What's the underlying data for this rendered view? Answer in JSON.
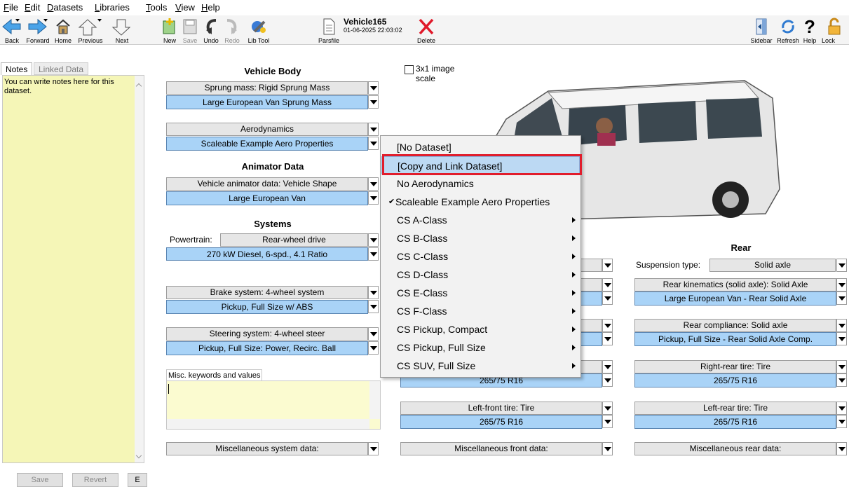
{
  "menu": [
    "File",
    "Edit",
    "Datasets",
    "Libraries",
    "Tools",
    "View",
    "Help"
  ],
  "toolbar": {
    "back": "Back",
    "forward": "Forward",
    "home": "Home",
    "previous": "Previous",
    "next": "Next",
    "new": "New",
    "save": "Save",
    "undo": "Undo",
    "redo": "Redo",
    "lib_tool": "Lib Tool",
    "parsfile": "Parsfile",
    "dataset_name": "Vehicle165",
    "dataset_date": "01-06-2025 22:03:02",
    "delete": "Delete",
    "sidebar": "Sidebar",
    "refresh": "Refresh",
    "help": "Help",
    "lock": "Lock"
  },
  "left": {
    "tabs": [
      "Notes",
      "Linked Data"
    ],
    "notes_text": "You can write notes here for this dataset.",
    "save": "Save",
    "revert": "Revert",
    "e": "E"
  },
  "image": {
    "checkbox_label": "3x1 image scale"
  },
  "vehicle_body": {
    "title": "Vehicle Body",
    "sprung_label": "Sprung mass: Rigid Sprung Mass",
    "sprung_value": "Large European Van Sprung Mass",
    "aero_label": "Aerodynamics",
    "aero_value": "Scaleable Example Aero Properties"
  },
  "animator": {
    "title": "Animator Data",
    "label": "Vehicle animator data: Vehicle Shape",
    "value": "Large European Van"
  },
  "systems": {
    "title": "Systems",
    "powertrain_label": "Powertrain:",
    "powertrain_type": "Rear-wheel drive",
    "powertrain_value": "270 kW Diesel, 6-spd., 4.1 Ratio",
    "brake_label": "Brake system: 4-wheel system",
    "brake_value": "Pickup, Full Size w/ ABS",
    "steering_label": "Steering system: 4-wheel steer",
    "steering_value": "Pickup, Full Size: Power, Recirc. Ball",
    "misc_kw_label": "Misc. keywords and values",
    "misc_system": "Miscellaneous system data:"
  },
  "front": {
    "right_tire_value": "265/75 R16",
    "left_tire_label": "Left-front tire: Tire",
    "left_tire_value": "265/75 R16",
    "misc": "Miscellaneous front data:"
  },
  "rear": {
    "title": "Rear",
    "susp_label": "Suspension type:",
    "susp_value": "Solid axle",
    "kin_label": "Rear kinematics (solid axle): Solid Axle",
    "kin_value": "Large European Van - Rear Solid Axle",
    "comp_label": "Rear compliance: Solid axle",
    "comp_value": "Pickup, Full Size - Rear Solid Axle Comp.",
    "right_tire_label": "Right-rear tire: Tire",
    "right_tire_value": "265/75 R16",
    "left_tire_label": "Left-rear tire: Tire",
    "left_tire_value": "265/75 R16",
    "misc": "Miscellaneous rear data:"
  },
  "popup": {
    "items": [
      {
        "label": "[No Dataset]",
        "submenu": false,
        "checked": false
      },
      {
        "label": "[Copy and Link Dataset]",
        "submenu": false,
        "checked": false,
        "highlight": true
      },
      {
        "label": "No Aerodynamics",
        "submenu": false,
        "checked": false
      },
      {
        "label": "Scaleable Example Aero Properties",
        "submenu": false,
        "checked": true
      },
      {
        "label": "CS A-Class",
        "submenu": true,
        "checked": false
      },
      {
        "label": "CS B-Class",
        "submenu": true,
        "checked": false
      },
      {
        "label": "CS C-Class",
        "submenu": true,
        "checked": false
      },
      {
        "label": "CS D-Class",
        "submenu": true,
        "checked": false
      },
      {
        "label": "CS E-Class",
        "submenu": true,
        "checked": false
      },
      {
        "label": "CS F-Class",
        "submenu": true,
        "checked": false
      },
      {
        "label": "CS Pickup, Compact",
        "submenu": true,
        "checked": false
      },
      {
        "label": "CS Pickup, Full Size",
        "submenu": true,
        "checked": false
      },
      {
        "label": "CS SUV, Full Size",
        "submenu": true,
        "checked": false
      }
    ],
    "highlight_color": "#e11d2c"
  }
}
